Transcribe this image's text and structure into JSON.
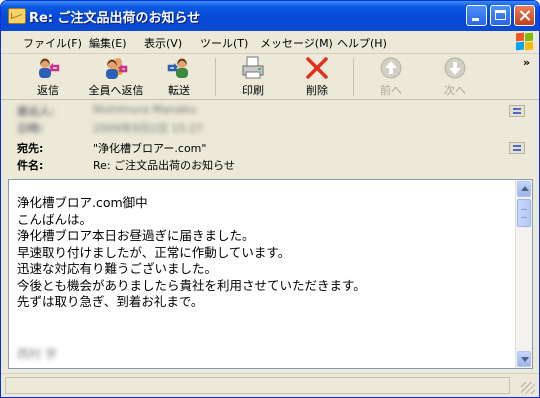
{
  "window": {
    "title": "Re: ご注文品出荷のお知らせ"
  },
  "menu": [
    {
      "label": "ファイル(F)"
    },
    {
      "label": "編集(E)"
    },
    {
      "label": "表示(V)"
    },
    {
      "label": "ツール(T)"
    },
    {
      "label": "メッセージ(M)"
    },
    {
      "label": "ヘルプ(H)"
    }
  ],
  "toolbar": {
    "reply": "返信",
    "reply_all": "全員へ返信",
    "forward": "転送",
    "print": "印刷",
    "delete": "削除",
    "previous": "前へ",
    "next": "次へ",
    "overflow": "»"
  },
  "header": {
    "from_label": "差出人:",
    "from_value": "Nishimura Manabu",
    "date_label": "日時:",
    "date_value": "2009年9月2日 15:27",
    "to_label": "宛先:",
    "to_value": "\"浄化槽ブロアー.com\"",
    "subject_label": "件名:",
    "subject_value": "Re: ご注文品出荷のお知らせ"
  },
  "message": {
    "lines": [
      "浄化槽ブロア.com御中",
      "こんばんは。",
      "浄化槽ブロア本日お昼過ぎに届きました。",
      "早速取り付けましたが、正常に作動しています。",
      "迅速な対応有り難うございました。",
      "今後とも機会がありましたら貴社を利用させていただきます。",
      "先ずは取り急ぎ、到着お礼まで。"
    ],
    "signature": "西村 学"
  },
  "colors": {
    "titlebar": "#0a58e0",
    "chrome": "#ece9d8",
    "delete_x": "#e0301e",
    "body_border": "#7f9db9"
  }
}
